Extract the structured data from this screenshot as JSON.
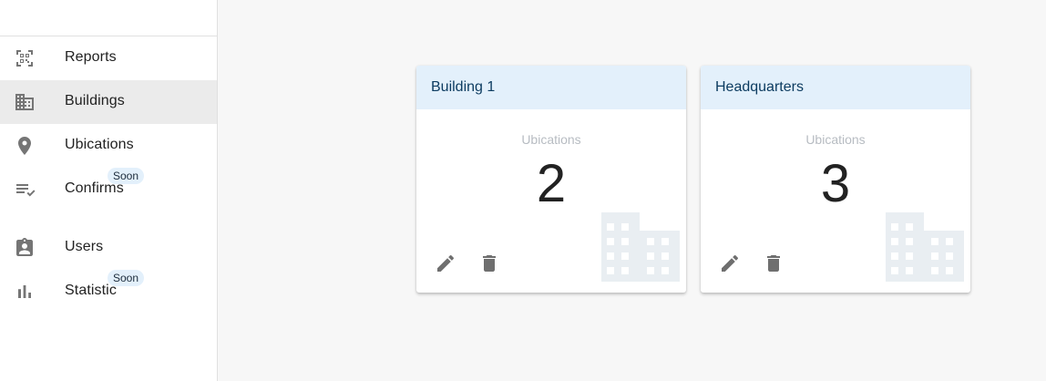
{
  "sidebar": {
    "items": [
      {
        "label": "Reports",
        "icon": "qr-scan-icon",
        "active": false
      },
      {
        "label": "Buildings",
        "icon": "building-icon",
        "active": true
      },
      {
        "label": "Ubications",
        "icon": "location-pin-icon",
        "active": false
      },
      {
        "label": "Confirms",
        "icon": "playlist-check-icon",
        "active": false,
        "badge": "Soon"
      },
      {
        "label": "Users",
        "icon": "user-badge-icon",
        "active": false
      },
      {
        "label": "Statistic",
        "icon": "bar-chart-icon",
        "active": false,
        "badge": "Soon"
      }
    ]
  },
  "cards": [
    {
      "title": "Building 1",
      "count_label": "Ubications",
      "count": "2"
    },
    {
      "title": "Headquarters",
      "count_label": "Ubications",
      "count": "3"
    }
  ],
  "colors": {
    "header_bg": "#e3f0fb",
    "title_text": "#0d3c61",
    "active_item_bg": "#ebebeb",
    "icon_gray": "#757575"
  }
}
